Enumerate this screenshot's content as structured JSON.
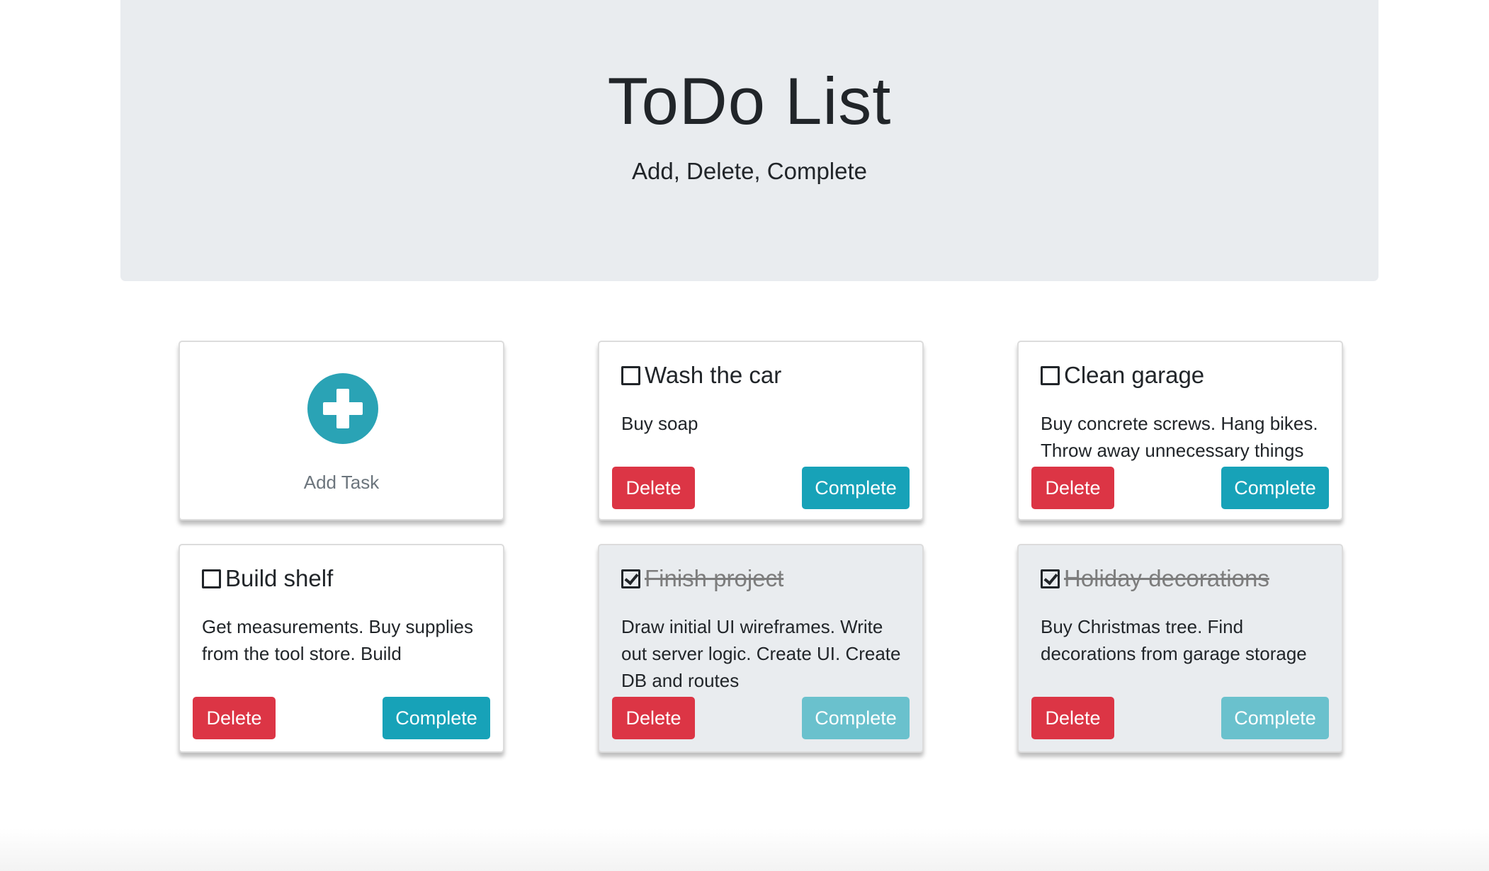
{
  "header": {
    "title": "ToDo List",
    "subtitle": "Add, Delete, Complete"
  },
  "add_card": {
    "label": "Add Task"
  },
  "colors": {
    "jumbotron_bg": "#e9ecef",
    "accent": "#17a2b8",
    "delete": "#dc3545",
    "completed_card_bg": "#e9ecef"
  },
  "tasks": [
    {
      "title": "Wash the car",
      "description": "Buy soap",
      "completed": false,
      "delete_label": "Delete",
      "complete_label": "Complete"
    },
    {
      "title": "Clean garage",
      "description": "Buy concrete screws. Hang bikes. Throw away unnecessary things",
      "completed": false,
      "delete_label": "Delete",
      "complete_label": "Complete"
    },
    {
      "title": "Build shelf",
      "description": "Get measurements. Buy supplies from the tool store. Build",
      "completed": false,
      "delete_label": "Delete",
      "complete_label": "Complete"
    },
    {
      "title": "Finish project",
      "description": "Draw initial UI wireframes. Write out server logic. Create UI. Create DB and routes",
      "completed": true,
      "delete_label": "Delete",
      "complete_label": "Complete"
    },
    {
      "title": "Holiday decorations",
      "description": "Buy Christmas tree. Find decorations from garage storage",
      "completed": true,
      "delete_label": "Delete",
      "complete_label": "Complete"
    }
  ]
}
